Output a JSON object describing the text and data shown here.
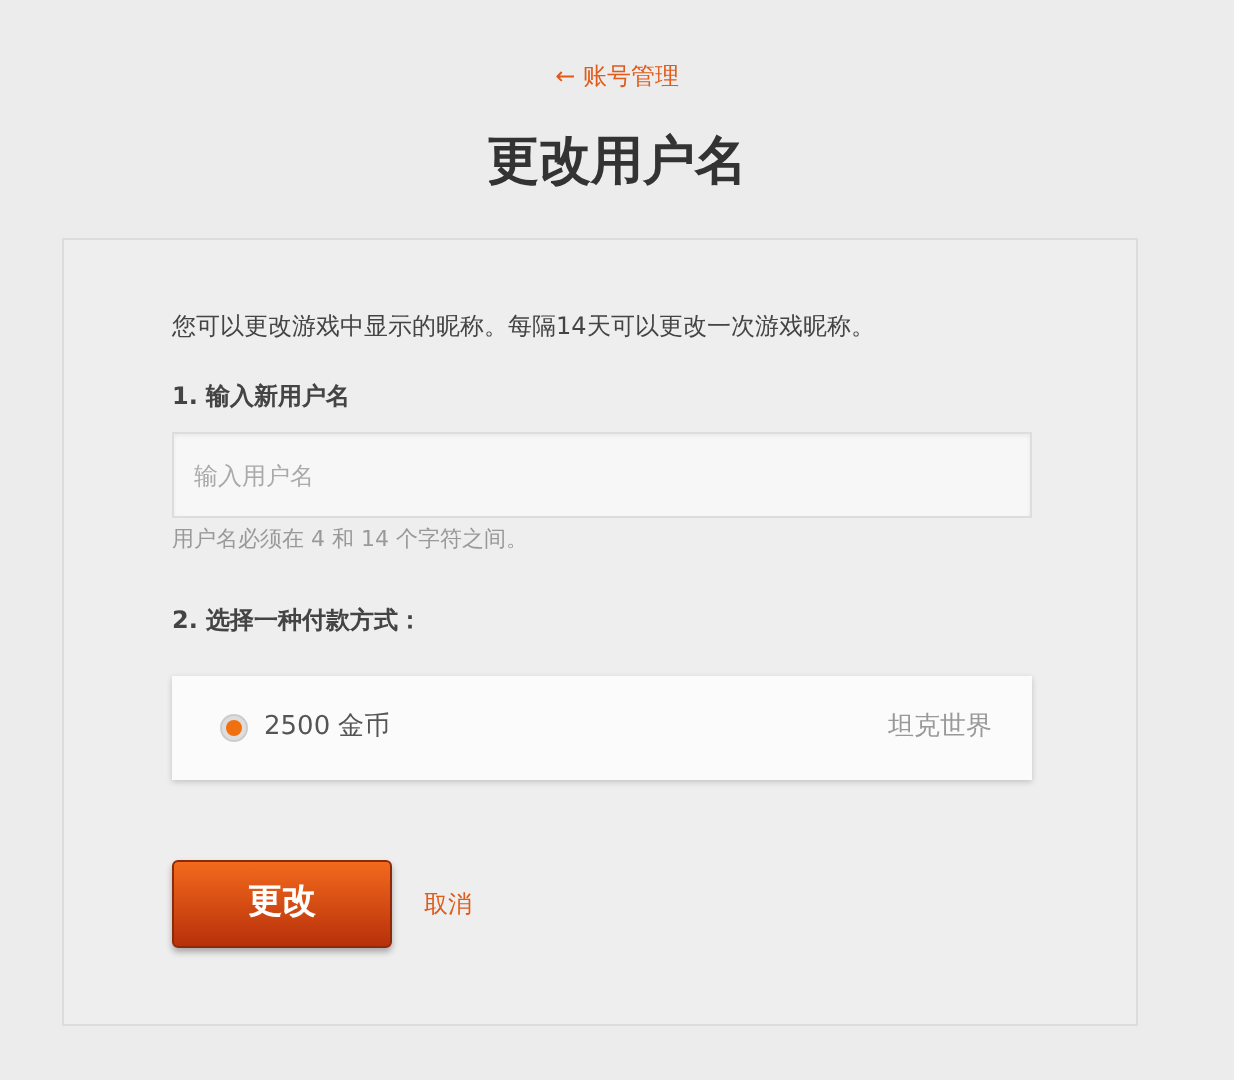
{
  "back_link": "← 账号管理",
  "title": "更改用户名",
  "intro": "您可以更改游戏中显示的昵称。每隔14天可以更改一次游戏昵称。",
  "step_1": {
    "label": "1. 输入新用户名",
    "placeholder": "输入用户名",
    "hint": "用户名必须在 4 和 14 个字符之间。"
  },
  "step_2": {
    "label": "2. 选择一种付款方式：",
    "options": [
      {
        "amount": "2500 金币",
        "game": "坦克世界",
        "selected": true
      }
    ]
  },
  "buttons": {
    "submit": "更改",
    "cancel": "取消"
  }
}
